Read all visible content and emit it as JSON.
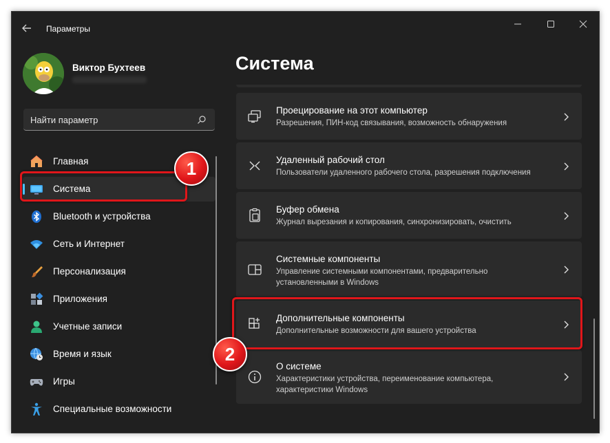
{
  "window": {
    "title": "Параметры"
  },
  "user": {
    "name": "Виктор Бухтеев"
  },
  "search": {
    "placeholder": "Найти параметр"
  },
  "nav": {
    "items": [
      {
        "label": "Главная",
        "icon": "home-icon"
      },
      {
        "label": "Система",
        "icon": "monitor-icon",
        "active": true
      },
      {
        "label": "Bluetooth и устройства",
        "icon": "bluetooth-icon"
      },
      {
        "label": "Сеть и Интернет",
        "icon": "wifi-icon"
      },
      {
        "label": "Персонализация",
        "icon": "brush-icon"
      },
      {
        "label": "Приложения",
        "icon": "apps-icon"
      },
      {
        "label": "Учетные записи",
        "icon": "person-icon"
      },
      {
        "label": "Время и язык",
        "icon": "globe-clock-icon"
      },
      {
        "label": "Игры",
        "icon": "gamepad-icon"
      },
      {
        "label": "Специальные возможности",
        "icon": "accessibility-icon"
      }
    ]
  },
  "main": {
    "title": "Система",
    "cards": [
      {
        "title": "Проецирование на этот компьютер",
        "desc": "Разрешения, ПИН-код связывания, возможность обнаружения",
        "icon": "projection-icon"
      },
      {
        "title": "Удаленный рабочий стол",
        "desc": "Пользователи удаленного рабочего стола, разрешения подключения",
        "icon": "remote-desktop-icon"
      },
      {
        "title": "Буфер обмена",
        "desc": "Журнал вырезания и копирования, синхронизировать, очистить",
        "icon": "clipboard-icon"
      },
      {
        "title": "Системные компоненты",
        "desc": "Управление системными компонентами, предварительно установленными в Windows",
        "icon": "system-components-icon"
      },
      {
        "title": "Дополнительные компоненты",
        "desc": "Дополнительные возможности для вашего устройства",
        "icon": "optional-features-icon"
      },
      {
        "title": "О системе",
        "desc": "Характеристики устройства, переименование компьютера, характеристики Windows",
        "icon": "info-icon"
      }
    ]
  },
  "annotations": {
    "badge1": "1",
    "badge2": "2"
  },
  "colors": {
    "accent": "#4cc2ff",
    "highlight": "#e0161a",
    "background": "#202020",
    "card": "#2b2b2b"
  }
}
